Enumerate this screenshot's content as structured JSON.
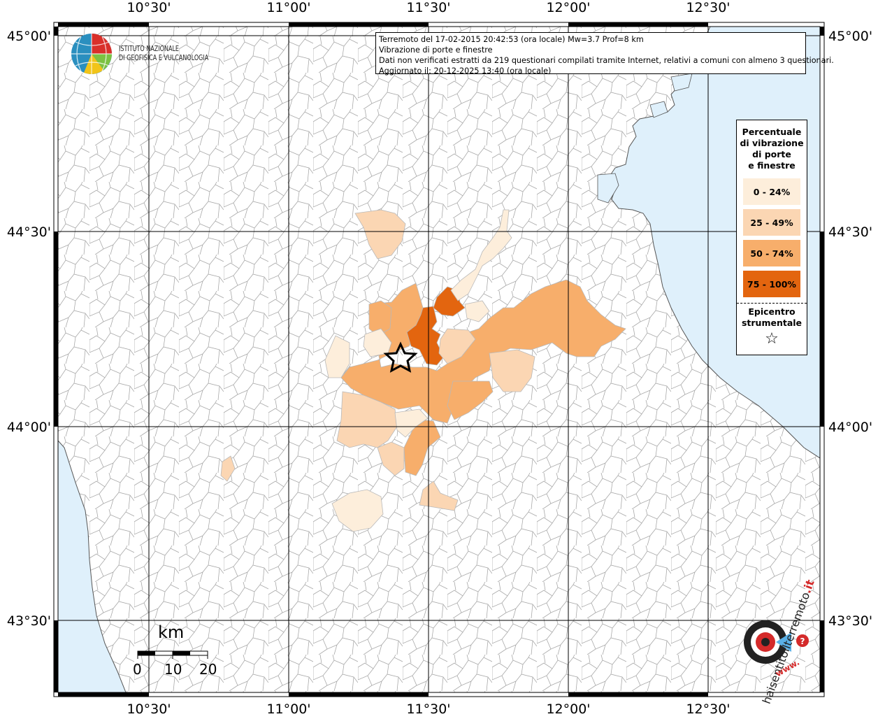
{
  "info": {
    "line1": "Terremoto del 17-02-2015 20:42:53 (ora locale) Mw=3.7 Prof=8 km",
    "line2": "Vibrazione di porte e finestre",
    "line3": "Dati non verificati estratti da 219 questionari compilati tramite Internet, relativi a comuni con almeno 3 questionari.",
    "line4": "Aggiornato il: 20-12-2025 13:40 (ora locale)"
  },
  "logo": {
    "line1": "ISTITUTO NAZIONALE",
    "line2": "DI GEOFISICA E VULCANOLOGIA"
  },
  "site_logo": {
    "text_dark": "haisentitoilterremoto",
    "text_red": ".it",
    "text_www": "www."
  },
  "longitude_labels": [
    "10°30'",
    "11°00'",
    "11°30'",
    "12°00'",
    "12°30'"
  ],
  "latitude_labels": [
    "45°00'",
    "44°30'",
    "44°00'",
    "43°30'"
  ],
  "legend": {
    "title_lines": [
      "Percentuale",
      "di vibrazione",
      "di porte",
      "e finestre"
    ],
    "classes": [
      {
        "label": "0 - 24%",
        "color": "#fdeedb"
      },
      {
        "label": "25 - 49%",
        "color": "#fbd6b3"
      },
      {
        "label": "50 - 74%",
        "color": "#f7ae6b"
      },
      {
        "label": "75 - 100%",
        "color": "#e3650f"
      }
    ],
    "epicenter_lines": [
      "Epicentro",
      "strumentale"
    ],
    "epicenter_symbol": "☆"
  },
  "scale_bar": {
    "unit": "km",
    "ticks": [
      "0",
      "10",
      "20"
    ]
  },
  "colors": {
    "sea": "#dff0fb",
    "boundary": "#9a9a9a",
    "grid": "#000000"
  }
}
